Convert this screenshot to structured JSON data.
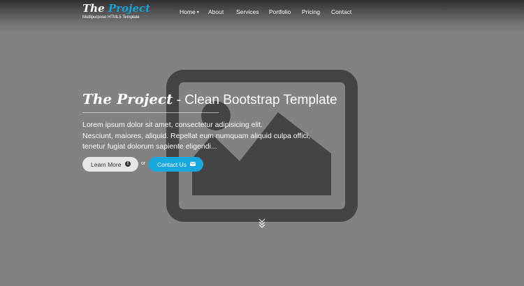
{
  "header": {
    "logo_prefix": "The ",
    "logo_accent": "Project",
    "tagline": "Multipurpose HTML5 Template",
    "accent_color": "#17a2d6"
  },
  "nav": {
    "items": [
      {
        "label": "Home",
        "has_dropdown": true
      },
      {
        "label": "About",
        "active": true
      },
      {
        "label": "Services"
      },
      {
        "label": "Portfolio"
      },
      {
        "label": "Pricing"
      },
      {
        "label": "Contact"
      }
    ]
  },
  "hero": {
    "title_brand": "The Project",
    "title_rest": " - Clean Bootstrap Template",
    "lead_lines": [
      "Lorem ipsum dolor sit amet, consectetur adipisicing elit.",
      "Nesciunt, maiores, aliquid. Repellat eum numquam aliquid culpa offici,",
      "tenetur fugiat dolorum sapiente eligendi..."
    ],
    "learn_more_label": "Learn More",
    "learn_more_icon": "info-circle-icon",
    "or_text": "or",
    "contact_label": "Contact Us",
    "contact_icon": "envelope-icon",
    "contact_color": "#16a8df",
    "scroll_icon": "double-chevron-down-icon",
    "background_image": "image-placeholder-icon"
  }
}
